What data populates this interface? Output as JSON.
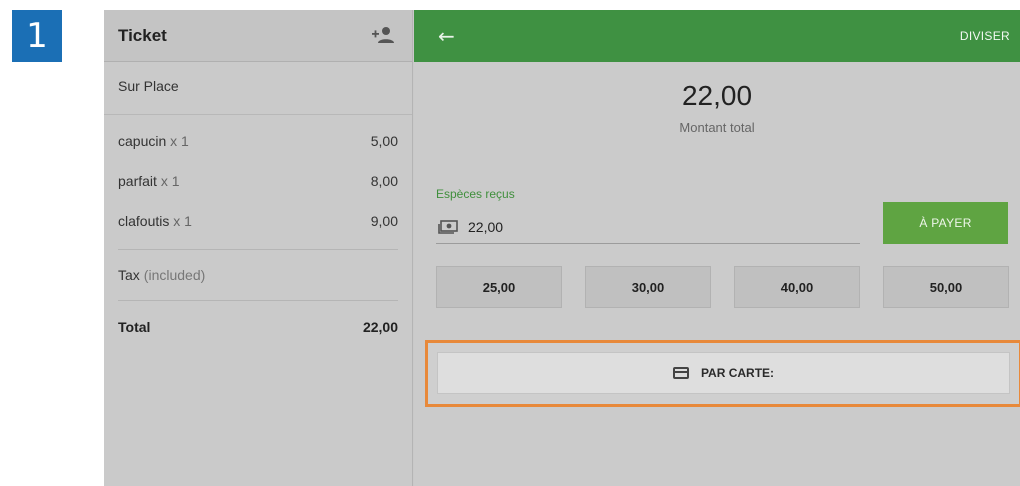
{
  "step_badge": "1",
  "ticket": {
    "title": "Ticket",
    "order_type": "Sur Place",
    "items": [
      {
        "name": "capucin",
        "qty": "x 1",
        "price": "5,00"
      },
      {
        "name": "parfait",
        "qty": "x 1",
        "price": "8,00"
      },
      {
        "name": "clafoutis",
        "qty": "x 1",
        "price": "9,00"
      }
    ],
    "tax_label": "Tax",
    "tax_note": "(included)",
    "total_label": "Total",
    "total_value": "22,00"
  },
  "payment": {
    "back_icon": "arrow-left-icon",
    "split_label": "DIVISER",
    "amount": "22,00",
    "amount_label": "Montant total",
    "cash_label": "Espèces reçus",
    "cash_value": "22,00",
    "pay_label": "À PAYER",
    "quick_amounts": [
      "25,00",
      "30,00",
      "40,00",
      "50,00"
    ],
    "card_label": "PAR CARTE:"
  },
  "colors": {
    "header_green": "#3f9142",
    "pay_button": "#5fa442",
    "highlight": "#e8893a",
    "badge": "#1b6fb5"
  }
}
